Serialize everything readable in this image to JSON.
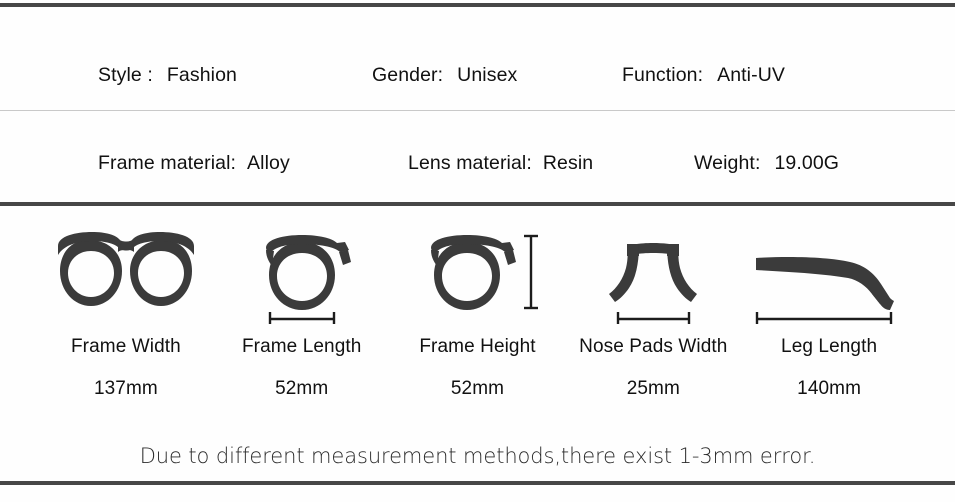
{
  "theme": {
    "page_background": "#fefefe",
    "rule_dark": "#474747",
    "rule_light": "#c9c9c9",
    "icon_color": "#3b3b3b",
    "text_color": "#111111"
  },
  "spec_rows": [
    {
      "fields": [
        {
          "label": "Style :",
          "value": "Fashion"
        },
        {
          "label": "Gender:",
          "value": "Unisex"
        },
        {
          "label": "Function:",
          "value": "Anti-UV"
        }
      ]
    },
    {
      "fields": [
        {
          "label": "Frame material:",
          "value": "Alloy"
        },
        {
          "label": "Lens material:",
          "value": "Resin"
        },
        {
          "label": "Weight:",
          "value": "19.00G"
        }
      ]
    }
  ],
  "measurements": [
    {
      "icon": "eyeglasses-front-icon",
      "name": "Frame Width",
      "value": "137mm",
      "bar": "horizontal"
    },
    {
      "icon": "single-lens-icon",
      "name": "Frame Length",
      "value": "52mm",
      "bar": "horizontal"
    },
    {
      "icon": "single-lens-icon",
      "name": "Frame Height",
      "value": "52mm",
      "bar": "vertical"
    },
    {
      "icon": "nose-bridge-icon",
      "name": "Nose Pads Width",
      "value": "25mm",
      "bar": "horizontal"
    },
    {
      "icon": "temple-arm-icon",
      "name": "Leg Length",
      "value": "140mm",
      "bar": "horizontal"
    }
  ],
  "disclaimer": "Due to different measurement methods,there exist 1-3mm error."
}
